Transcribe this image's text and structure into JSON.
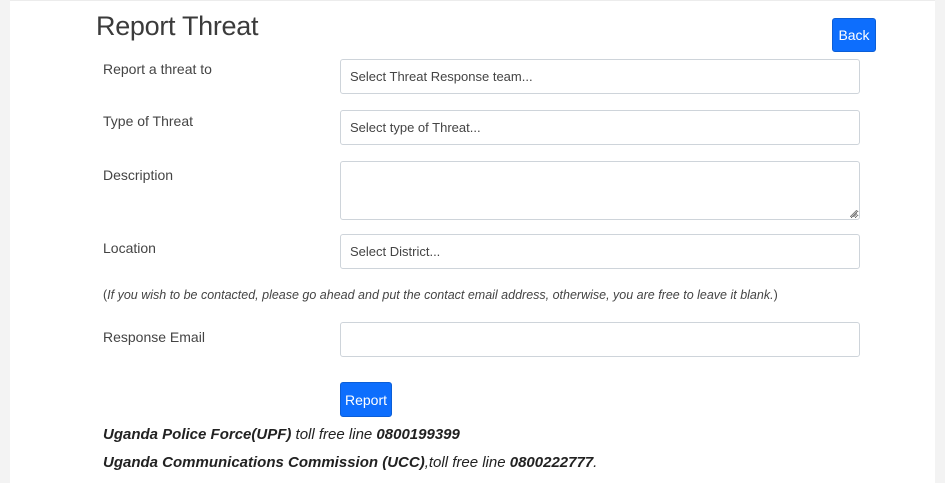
{
  "page": {
    "title": "Report Threat",
    "back_label": "Back"
  },
  "form": {
    "report_to": {
      "label": "Report a threat to",
      "value": "Select Threat Response team..."
    },
    "threat_type": {
      "label": "Type of Threat",
      "value": "Select type of Threat..."
    },
    "description": {
      "label": "Description",
      "value": ""
    },
    "location": {
      "label": "Location",
      "value": "Select District..."
    },
    "note": {
      "open": "(",
      "text": "If you wish to be contacted, please go ahead and put the contact email address, otherwise, you are free to leave it blank.",
      "close": ")"
    },
    "response_email": {
      "label": "Response Email",
      "value": ""
    },
    "submit_label": "Report"
  },
  "hotlines": [
    {
      "org": "Uganda Police Force(UPF)",
      "text": " toll free line ",
      "number": "0800199399",
      "suffix": ""
    },
    {
      "org": "Uganda Communications Commission (UCC)",
      "text": ",toll free line ",
      "number": "0800222777",
      "suffix": "."
    }
  ],
  "colors": {
    "primary": "#0d6efd",
    "border": "#ced4da",
    "background": "#ffffff"
  }
}
